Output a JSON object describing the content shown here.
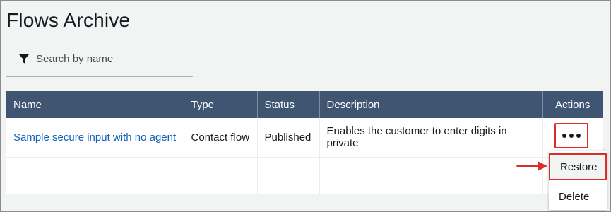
{
  "page": {
    "title": "Flows Archive"
  },
  "search": {
    "placeholder": "Search by name",
    "value": ""
  },
  "table": {
    "columns": [
      "Name",
      "Type",
      "Status",
      "Description",
      "Actions"
    ],
    "rows": [
      {
        "name": "Sample secure input with no agent",
        "type": "Contact flow",
        "status": "Published",
        "description": "Enables the customer to enter digits in private"
      }
    ]
  },
  "actions_menu": {
    "items": [
      "Restore",
      "Delete"
    ]
  },
  "colors": {
    "header_bg": "#3f5571",
    "link": "#0f5fb8",
    "highlight": "#e02b2b"
  },
  "icons": {
    "filter": "filter-icon",
    "more": "more-actions-icon",
    "arrow": "callout-arrow-icon"
  }
}
